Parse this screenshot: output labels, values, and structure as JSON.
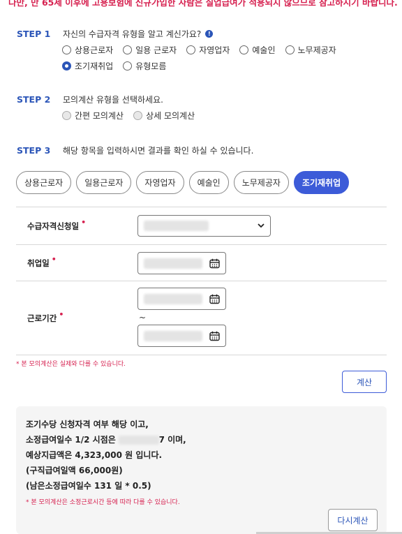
{
  "top_notice": "다만, 만 65세 이후에 고용보험에 신규가입한 사람은 실업급여가 적용되지 않으므로 참고하시기 바랍니다.",
  "step1": {
    "label": "STEP 1",
    "question": "자신의 수급자격 유형을 알고 계신가요?",
    "info_icon": "info-icon",
    "options": [
      "상용근로자",
      "일용 근로자",
      "자영업자",
      "예술인",
      "노무제공자",
      "조기재취업",
      "유형모름"
    ],
    "selected": "조기재취업"
  },
  "step2": {
    "label": "STEP 2",
    "question": "모의계산 유형을 선택하세요.",
    "options": [
      "간편 모의계산",
      "상세 모의계산"
    ]
  },
  "step3": {
    "label": "STEP 3",
    "question": "해당 항목을 입력하시면 결과를 확인 하실 수 있습니다."
  },
  "tabs": [
    {
      "label": "상용근로자",
      "active": false
    },
    {
      "label": "일용근로자",
      "active": false
    },
    {
      "label": "자영업자",
      "active": false
    },
    {
      "label": "예술인",
      "active": false
    },
    {
      "label": "노무제공자",
      "active": false
    },
    {
      "label": "조기재취업",
      "active": true
    }
  ],
  "form": {
    "required_mark": "•",
    "apply_date_label": "수급자격신청일",
    "employ_date_label": "취업일",
    "work_period_label": "근로기간",
    "tilde": "~",
    "select_icon": "chevron-down-icon",
    "calendar_icon": "calendar-icon"
  },
  "note_simulation": "* 본 모의계산은 실제와 다를 수 있습니다.",
  "calc_button": "계산",
  "result": {
    "line1": "조기수당 신청자격 여부 해당 이고,",
    "line2_prefix": "소정급여일수 1/2 시점은",
    "line2_suffix": "7 이며,",
    "line3": "예상지급액은 4,323,000 원 입니다.",
    "line4": "(구직급여일액 66,000원)",
    "line5": "(남은소정급여일수 131 일 * 0.5)",
    "note": "* 본 모의계산은 소정근로시간 등에 따라 다를 수 있습니다.",
    "recalc_button": "다시계산"
  },
  "colors": {
    "accent": "#3c5bd8",
    "step": "#2b55b8",
    "warning": "#d6204f"
  }
}
